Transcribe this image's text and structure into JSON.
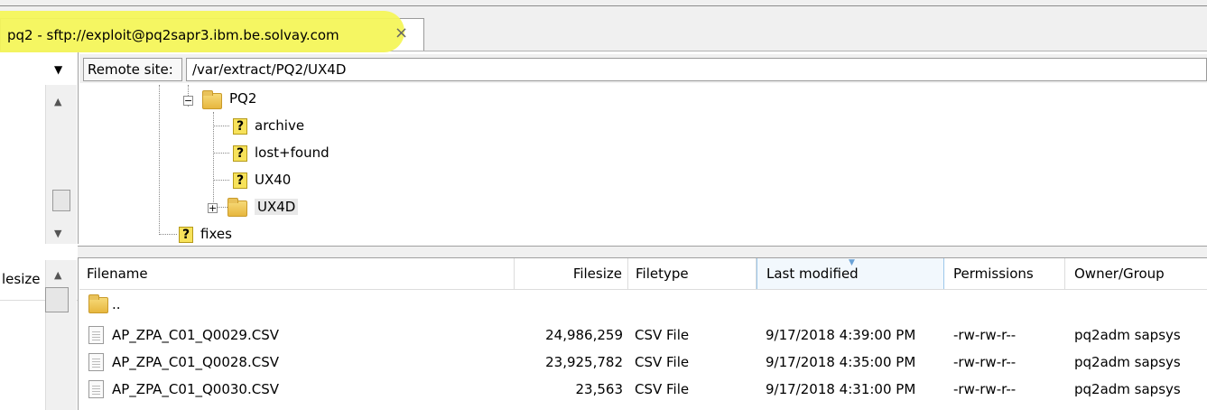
{
  "tab": {
    "title": "pq2 - sftp://exploit@pq2sapr3.ibm.be.solvay.com",
    "close_glyph": "×"
  },
  "remote": {
    "label": "Remote site:",
    "path": "/var/extract/PQ2/UX4D"
  },
  "left_panel": {
    "bottom_header_label": "lesize"
  },
  "tree": {
    "items": [
      {
        "label": "PQ2",
        "icon": "folder-icon",
        "expander": "−"
      },
      {
        "label": "archive",
        "icon": "unknown-folder-icon"
      },
      {
        "label": "lost+found",
        "icon": "unknown-folder-icon"
      },
      {
        "label": "UX40",
        "icon": "unknown-folder-icon"
      },
      {
        "label": "UX4D",
        "icon": "folder-icon",
        "expander": "+"
      },
      {
        "label": "fixes",
        "icon": "unknown-folder-icon"
      }
    ]
  },
  "filelist": {
    "columns": [
      "Filename",
      "Filesize",
      "Filetype",
      "Last modified",
      "Permissions",
      "Owner/Group"
    ],
    "sorted_column": "Last modified",
    "parent_dir": "..",
    "rows": [
      {
        "filename": "AP_ZPA_C01_Q0029.CSV",
        "filesize": "24,986,259",
        "filetype": "CSV File",
        "modified": "9/17/2018 4:39:00 PM",
        "permissions": "-rw-rw-r--",
        "owner": "pq2adm sapsys"
      },
      {
        "filename": "AP_ZPA_C01_Q0028.CSV",
        "filesize": "23,925,782",
        "filetype": "CSV File",
        "modified": "9/17/2018 4:35:00 PM",
        "permissions": "-rw-rw-r--",
        "owner": "pq2adm sapsys"
      },
      {
        "filename": "AP_ZPA_C01_Q0030.CSV",
        "filesize": "23,563",
        "filetype": "CSV File",
        "modified": "9/17/2018 4:31:00 PM",
        "permissions": "-rw-rw-r--",
        "owner": "pq2adm sapsys"
      }
    ]
  },
  "colors": {
    "highlight": "#f4f55a",
    "sorted_header": "#f2f8fd"
  }
}
